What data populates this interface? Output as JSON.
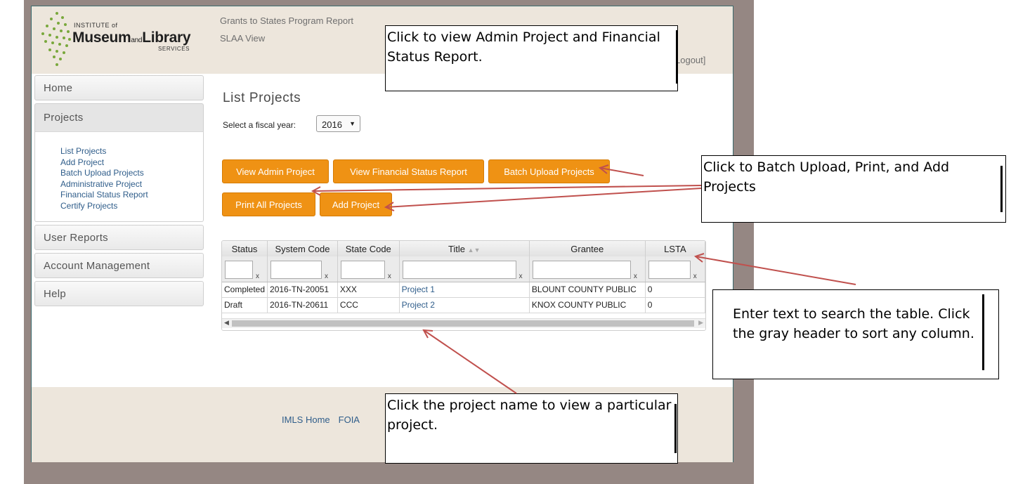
{
  "header": {
    "logo_institute": "INSTITUTE of",
    "logo_main": "Museum",
    "logo_and": "and",
    "logo_library": "Library",
    "logo_services": "SERVICES",
    "title": "Grants to States Program Report",
    "subtitle": "SLAA View",
    "logout": "Logout]"
  },
  "sidebar": {
    "home": "Home",
    "projects": "Projects",
    "project_links": [
      "List Projects",
      "Add Project",
      "Batch Upload Projects",
      "Administrative Project",
      "Financial Status Report",
      "Certify Projects"
    ],
    "user_reports": "User Reports",
    "account_management": "Account Management",
    "help": "Help"
  },
  "main": {
    "page_title": "List Projects",
    "fiscal_label": "Select a fiscal year:",
    "fiscal_value": "2016",
    "buttons": {
      "view_admin": "View Admin Project",
      "view_fsr": "View Financial Status Report",
      "batch_upload": "Batch Upload Projects",
      "print_all": "Print All Projects",
      "add_project": "Add Project"
    }
  },
  "table": {
    "columns": [
      "Status",
      "System Code",
      "State Code",
      "Title",
      "Grantee",
      "LSTA"
    ],
    "filter_clear": "x",
    "rows": [
      [
        "Completed",
        "2016-TN-20051",
        "XXX",
        "Project 1",
        "BLOUNT COUNTY PUBLIC",
        "0"
      ],
      [
        "Draft",
        "2016-TN-20611",
        "CCC",
        "Project 2",
        "KNOX COUNTY PUBLIC",
        "0"
      ]
    ]
  },
  "footer": {
    "imls_home": "IMLS Home",
    "foia": "FOIA"
  },
  "callouts": {
    "admin_fsr": "Click to view Admin Project and Financial Status Report.",
    "batch_print_add": "Click to Batch Upload, Print, and Add Projects",
    "search_sort": "Enter text to search the table. Click the gray header to sort any column.",
    "project_name": "Click the project name to view a particular project."
  },
  "colors": {
    "button_orange": "#ef9214",
    "header_beige": "#ede6dc",
    "frame_taupe": "#958783",
    "link_blue": "#2f5d8a",
    "arrow_red": "#c0504d"
  }
}
